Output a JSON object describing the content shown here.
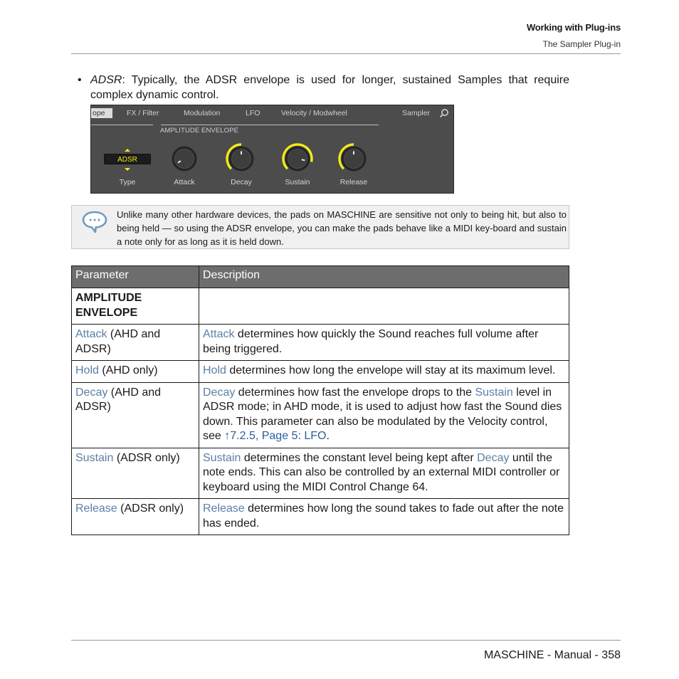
{
  "header": {
    "chapter": "Working with Plug-ins",
    "section": "The Sampler Plug-in"
  },
  "bullet": {
    "marker": "•",
    "term": "ADSR",
    "text": ": Typically, the ADSR envelope is used for longer, sustained Samples that require complex dynamic control."
  },
  "plugin_panel": {
    "tabs": [
      {
        "label": "ope",
        "active": true
      },
      {
        "label": "FX / Filter",
        "active": false
      },
      {
        "label": "Modulation",
        "active": false
      },
      {
        "label": "LFO",
        "active": false
      },
      {
        "label": "Velocity / Modwheel",
        "active": false
      }
    ],
    "plugin_name": "Sampler",
    "search_icon": "search-icon",
    "section_label": "AMPLITUDE ENVELOPE",
    "type_selector": {
      "value": "ADSR",
      "label": "Type"
    },
    "knobs": [
      {
        "label": "Attack",
        "value": 0.05
      },
      {
        "label": "Decay",
        "value": 0.5
      },
      {
        "label": "Sustain",
        "value": 0.88
      },
      {
        "label": "Release",
        "value": 0.5
      }
    ],
    "accent_color": "#f2ea1a"
  },
  "note": {
    "icon": "speech-bubble-icon",
    "text": "Unlike many other hardware devices, the pads on MASCHINE are sensitive not only to being hit, but also to being held — so using the ADSR envelope, you can make the pads behave like a MIDI key-board and sustain a note only for as long as it is held down."
  },
  "table": {
    "headers": [
      "Parameter",
      "Description"
    ],
    "section": "AMPLITUDE ENVELOPE",
    "rows": [
      {
        "param": "Attack",
        "param_suffix": " (AHD and ADSR)",
        "desc": [
          {
            "t": "Attack",
            "link": true
          },
          {
            "t": " determines how quickly the Sound reaches full volume after being triggered."
          }
        ]
      },
      {
        "param": "Hold",
        "param_suffix": " (AHD only)",
        "desc": [
          {
            "t": "Hold",
            "link": true
          },
          {
            "t": " determines how long the envelope will stay at its maximum level."
          }
        ]
      },
      {
        "param": "Decay",
        "param_suffix": " (AHD and ADSR)",
        "desc": [
          {
            "t": "Decay",
            "link": true
          },
          {
            "t": " determines how fast the envelope drops to the "
          },
          {
            "t": "Sustain",
            "link": true
          },
          {
            "t": " level in ADSR mode; in AHD mode, it is used to adjust how fast the Sound dies down. This parameter can also be modulated by the Velocity control, see "
          },
          {
            "t": "↑7.2.5, Page 5: LFO",
            "xref": true
          },
          {
            "t": "."
          }
        ]
      },
      {
        "param": "Sustain",
        "param_suffix": " (ADSR only)",
        "desc": [
          {
            "t": "Sustain",
            "link": true
          },
          {
            "t": " determines the constant level being kept after "
          },
          {
            "t": "Decay",
            "link": true
          },
          {
            "t": " until the note ends. This can also be controlled by an external MIDI controller or keyboard using the MIDI Control Change 64."
          }
        ]
      },
      {
        "param": "Release",
        "param_suffix": " (ADSR only)",
        "desc": [
          {
            "t": "Release",
            "link": true
          },
          {
            "t": " determines how long the sound takes to fade out after the note has ended."
          }
        ]
      }
    ]
  },
  "footer": {
    "text": "MASCHINE - Manual - 358"
  }
}
